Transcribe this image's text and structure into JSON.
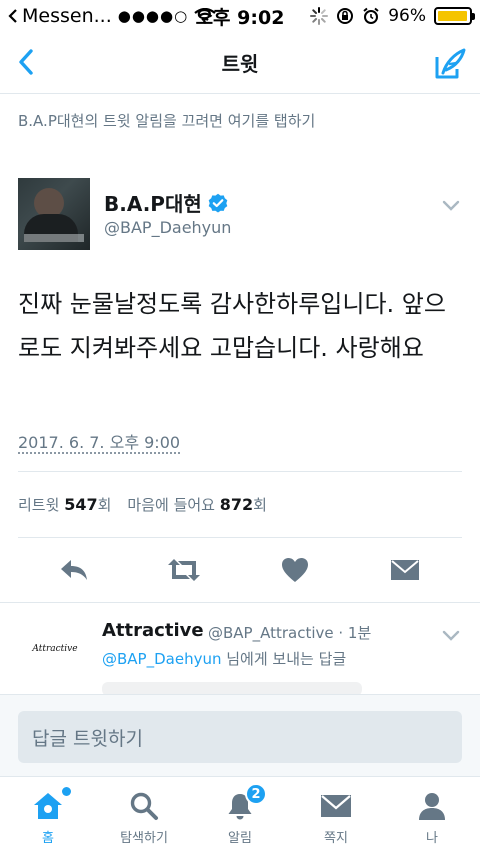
{
  "status_bar": {
    "back_app": "Messen...",
    "signal": "●●●●○",
    "time": "오후 9:02",
    "battery": "96%",
    "battery_level": 0.96
  },
  "nav": {
    "title": "트윗"
  },
  "notification_banner": "B.A.P대현의 트윗 알림을 끄려면 여기를 탭하기",
  "tweet": {
    "name": "B.A.P대현",
    "handle": "@BAP_Daehyun",
    "text": "진짜 눈물날정도록 감사한하루입니다. 앞으로도 지켜봐주세요 고맙습니다. 사랑해요",
    "timestamp": "2017. 6. 7. 오후 9:00",
    "retweets_label": "리트윗",
    "retweets": "547",
    "retweets_unit": "회",
    "likes_label": "마음에 들어요",
    "likes": "872",
    "likes_unit": "회"
  },
  "reply": {
    "name": "Attractive",
    "handle": "@BAP_Attractive · 1분",
    "avatar_text": "Attractive",
    "to_mention": "@BAP_Daehyun",
    "to_suffix": " 님에게 보내는 답글"
  },
  "composer": {
    "placeholder": "답글 트윗하기"
  },
  "tabs": [
    {
      "label": "홈",
      "icon": "home-icon"
    },
    {
      "label": "탐색하기",
      "icon": "search-icon"
    },
    {
      "label": "알림",
      "icon": "bell-icon",
      "badge": "2"
    },
    {
      "label": "쪽지",
      "icon": "envelope-icon"
    },
    {
      "label": "나",
      "icon": "person-icon"
    }
  ],
  "colors": {
    "accent": "#1da1f2",
    "secondary_text": "#657786",
    "icon_gray": "#657786"
  }
}
